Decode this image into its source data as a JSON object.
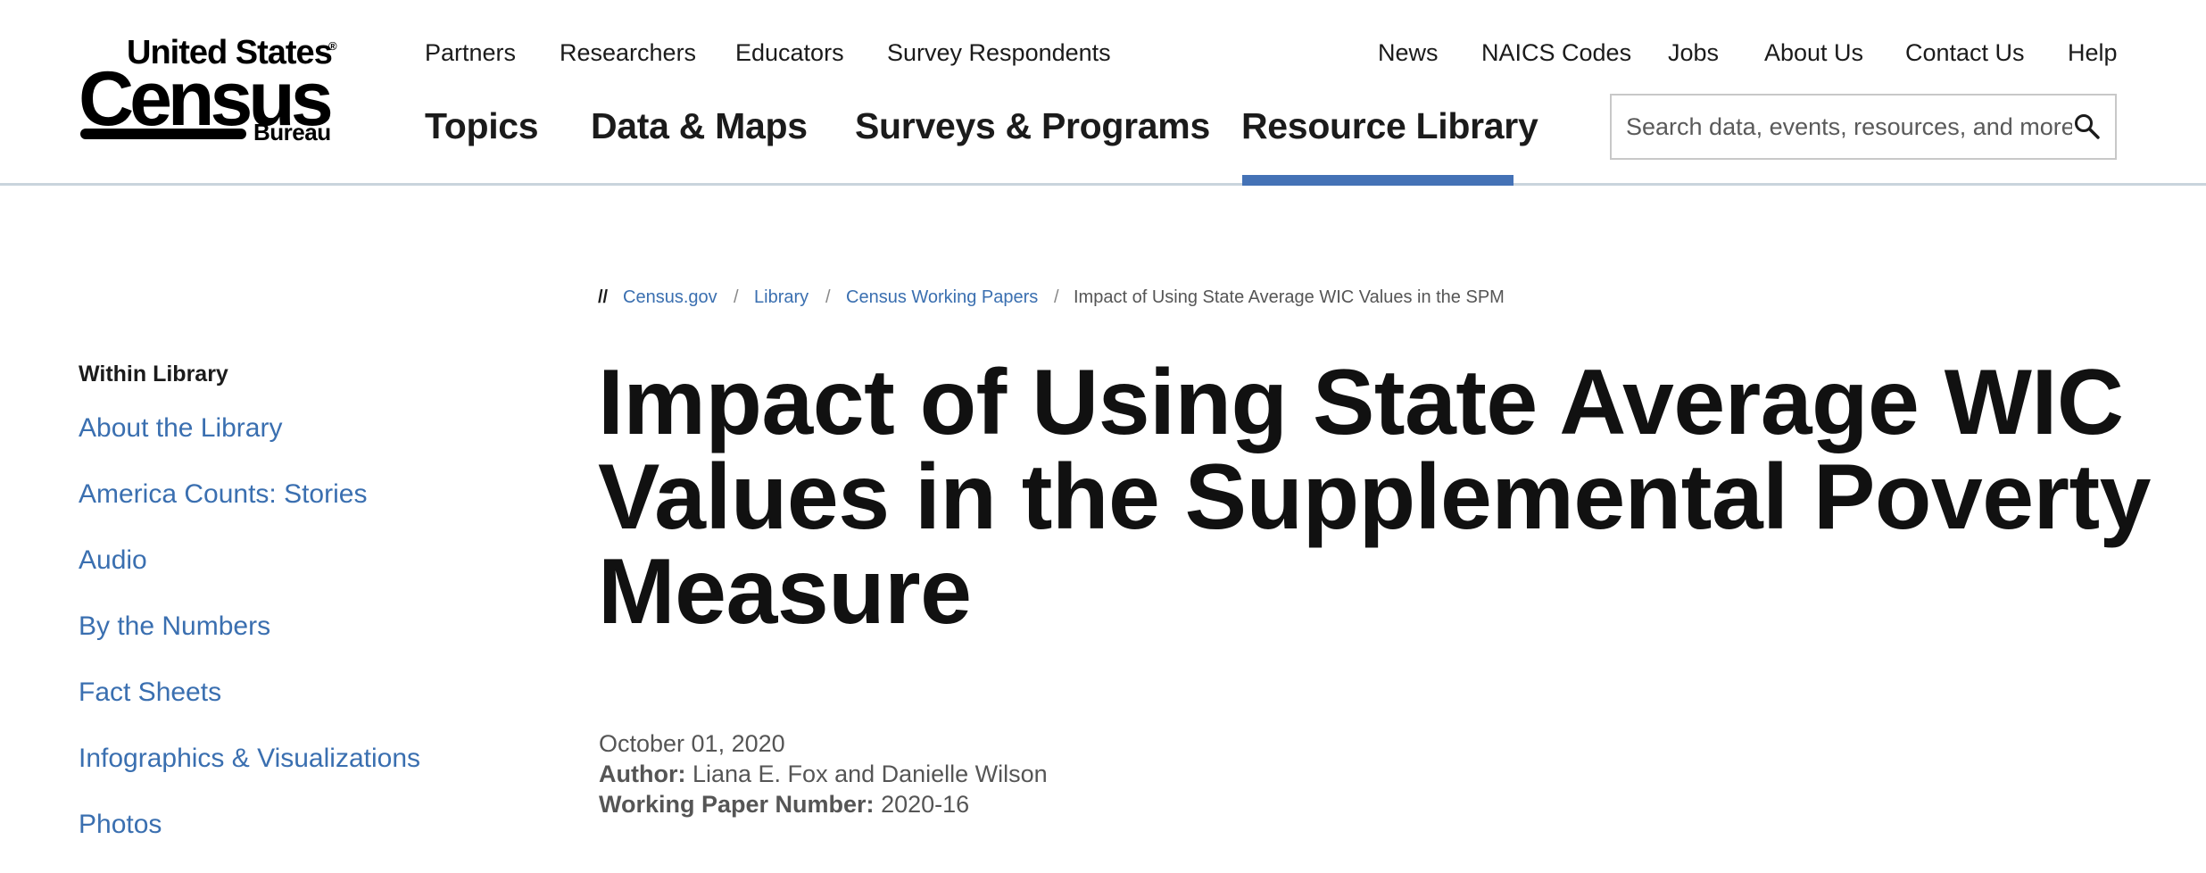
{
  "logo": {
    "line1": "United States",
    "registered": "®",
    "line2": "Census",
    "line3": "Bureau"
  },
  "utility_nav": [
    "Partners",
    "Researchers",
    "Educators",
    "Survey Respondents"
  ],
  "utility_nav_right": [
    "News",
    "NAICS Codes",
    "Jobs",
    "About Us",
    "Contact Us",
    "Help"
  ],
  "main_nav": [
    "Topics",
    "Data & Maps",
    "Surveys & Programs",
    "Resource Library"
  ],
  "main_nav_active": "Resource Library",
  "search": {
    "placeholder": "Search data, events, resources, and more"
  },
  "breadcrumb": {
    "prefix": "//",
    "items": [
      "Census.gov",
      "Library",
      "Census Working Papers"
    ],
    "separator": "/",
    "current": "Impact of Using State Average WIC Values in the SPM"
  },
  "sidebar": {
    "heading": "Within Library",
    "items": [
      "About the Library",
      "America Counts: Stories",
      "Audio",
      "By the Numbers",
      "Fact Sheets",
      "Infographics & Visualizations",
      "Photos"
    ]
  },
  "article": {
    "title": "Impact of Using State Average WIC Values in the Supplemental Poverty Measure",
    "date": "October 01, 2020",
    "author_label": "Author:",
    "author": "Liana E. Fox and Danielle Wilson",
    "paper_number_label": "Working Paper Number:",
    "paper_number": "2020-16"
  },
  "colors": {
    "link": "#3a6fb0",
    "active_tab": "#4472b6",
    "header_border": "#c9d4dc",
    "title": "#111111"
  }
}
